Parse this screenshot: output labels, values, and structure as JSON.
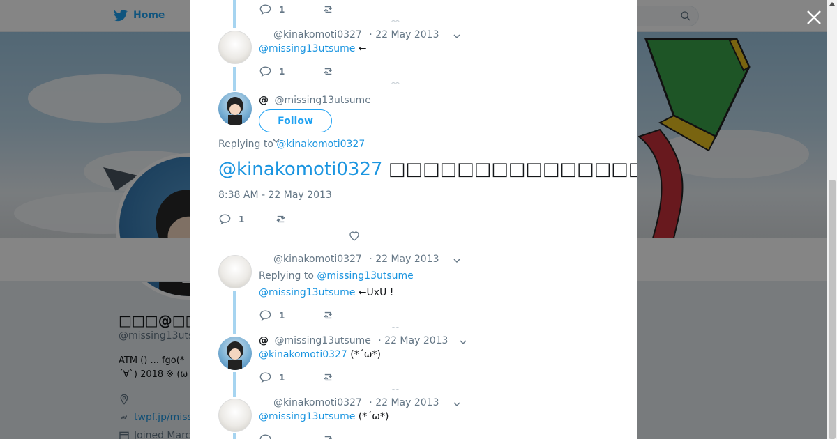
{
  "nav": {
    "home_label": "Home"
  },
  "profile": {
    "name": "□□□@□□□□",
    "handle": "@missing13uts",
    "bio_line1": "ATM () ...  fgo(*",
    "bio_line2": "´∀`) 2018 ※ (ω",
    "link": "twpf.jp/miss",
    "joined": "Joined Marc"
  },
  "top_partial": {
    "reply_count": "1"
  },
  "tweets": [
    {
      "handle": "@kinakomoti0327",
      "date": "· 22 May 2013",
      "mention": "@missing13utsume",
      "text": " ←",
      "reply_count": "1"
    }
  ],
  "main_tweet": {
    "name_symbol": "@",
    "handle": "@missing13utsume",
    "follow_label": "Follow",
    "replying_to_label": "Replying to",
    "replying_to": "@kinakomoti0327",
    "mention": "@kinakomoti0327",
    "text": " □□□□□□□□□□□□□□□□□□□□□□□□□□□□□□□□□□□□□□□□www",
    "timestamp": "8:38 AM - 22 May 2013",
    "reply_count": "1"
  },
  "replies": [
    {
      "handle": "@kinakomoti0327",
      "date": "· 22 May 2013",
      "replying_to_label": "Replying to",
      "replying_to": "@missing13utsume",
      "mention": "@missing13utsume",
      "text": " ←UxU !",
      "reply_count": "1"
    },
    {
      "name_symbol": "@",
      "handle": "@missing13utsume",
      "date": "· 22 May 2013",
      "mention": "@kinakomoti0327",
      "text": " (*´ω*)",
      "reply_count": "1"
    },
    {
      "handle": "@kinakomoti0327",
      "date": "· 22 May 2013",
      "mention": "@missing13utsume",
      "text": " (*´ω*)"
    }
  ],
  "colors": {
    "accent": "#1da1f2",
    "link": "#1b95e0",
    "thread": "#a6d4f0",
    "muted": "#657786"
  }
}
